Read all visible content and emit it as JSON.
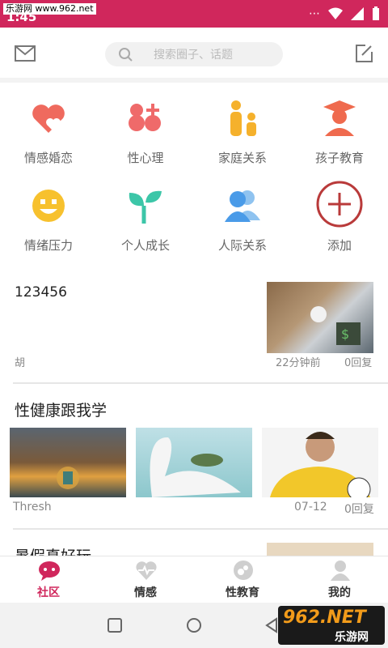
{
  "status_bar": {
    "watermark": "乐游网 www.962.net",
    "time": "1:45"
  },
  "search": {
    "placeholder": "搜索圈子、话题"
  },
  "categories": [
    {
      "label": "情感婚恋",
      "icon": "hearts-icon",
      "color": "#ef6a5e"
    },
    {
      "label": "性心理",
      "icon": "gender-icon",
      "color": "#ef6a6a"
    },
    {
      "label": "家庭关系",
      "icon": "family-icon",
      "color": "#f5b12c"
    },
    {
      "label": "孩子教育",
      "icon": "graduate-icon",
      "color": "#ef6a4e"
    },
    {
      "label": "情绪压力",
      "icon": "smile-icon",
      "color": "#f7c12e"
    },
    {
      "label": "个人成长",
      "icon": "sprout-icon",
      "color": "#3cc6a8"
    },
    {
      "label": "人际关系",
      "icon": "people-icon",
      "color": "#4a9be8"
    },
    {
      "label": "添加",
      "icon": "add-icon",
      "color": "#b93a3a"
    }
  ],
  "post1": {
    "title": "123456",
    "author": "胡",
    "time": "22分钟前",
    "replies": "0回复"
  },
  "section2": {
    "title": "性健康跟我学",
    "author": "Thresh",
    "date": "07-12",
    "replies": "0回复"
  },
  "section3": {
    "title": "暑假真好玩"
  },
  "tabs": [
    {
      "label": "社区",
      "icon": "chat-bubble-icon"
    },
    {
      "label": "情感",
      "icon": "heart-pulse-icon"
    },
    {
      "label": "性教育",
      "icon": "gender-circle-icon"
    },
    {
      "label": "我的",
      "icon": "user-icon"
    }
  ],
  "watermark_logo": {
    "text": "962.NET",
    "subtext": "乐游网"
  }
}
